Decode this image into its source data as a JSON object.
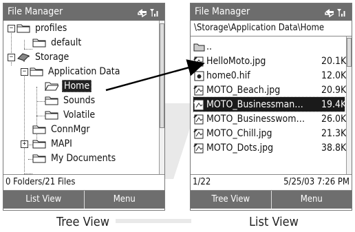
{
  "tree_view": {
    "title": "File Manager",
    "items": [
      {
        "label": "profiles",
        "expander": "−"
      },
      {
        "label": "default",
        "expander": ""
      },
      {
        "label": "Storage",
        "expander": "−"
      },
      {
        "label": "Application Data",
        "expander": "−"
      },
      {
        "label": "Home",
        "expander": "",
        "selected": true
      },
      {
        "label": "Sounds",
        "expander": ""
      },
      {
        "label": "Volatile",
        "expander": ""
      },
      {
        "label": "ConnMgr",
        "expander": ""
      },
      {
        "label": "MAPI",
        "expander": "+"
      },
      {
        "label": "My Documents",
        "expander": ""
      }
    ],
    "status": "0 Folders/21 Files",
    "softkeys": {
      "left": "List View",
      "right": "Menu"
    },
    "caption": "Tree View"
  },
  "list_view": {
    "title": "File Manager",
    "path": "\\Storage\\Application Data\\Home",
    "files": [
      {
        "name": "..",
        "size": ""
      },
      {
        "name": "HelloMoto.jpg",
        "size": "20.1K"
      },
      {
        "name": "home0.hif",
        "size": "12.0K"
      },
      {
        "name": "MOTO_Beach.jpg",
        "size": "20.9K"
      },
      {
        "name": "MOTO_Businessman…",
        "size": "19.4K",
        "selected": true
      },
      {
        "name": "MOTO_Businesswom…",
        "size": "26.0K"
      },
      {
        "name": "MOTO_Chill.jpg",
        "size": "21.3K"
      },
      {
        "name": "MOTO_Dots.jpg",
        "size": "38.8K"
      }
    ],
    "status_left": "1/22",
    "status_right": "5/25/03 7:26 PM",
    "softkeys": {
      "left": "Tree View",
      "right": "Menu"
    },
    "caption": "List View"
  },
  "colors": {
    "titlebar": "#6d6d6d",
    "softkeys": "#6e6e6e",
    "selection": "#1a1a1a"
  }
}
